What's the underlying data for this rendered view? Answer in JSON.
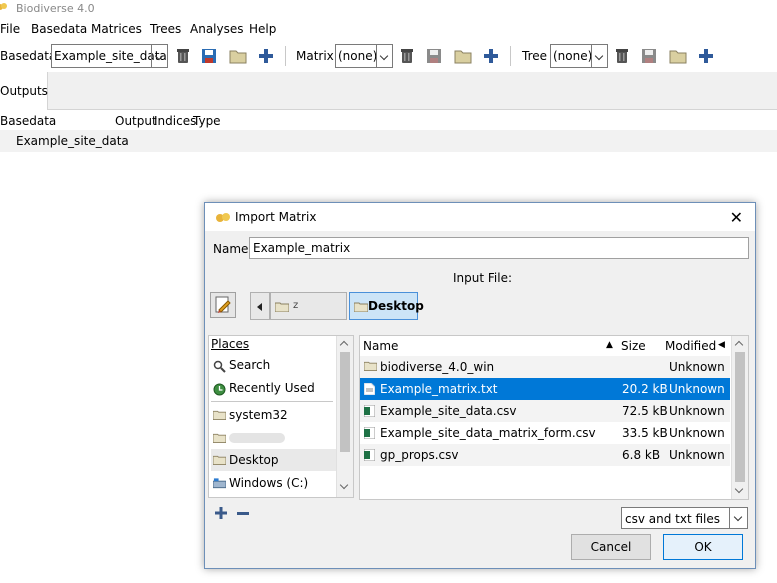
{
  "app": {
    "title": "Biodiverse 4.0"
  },
  "menu": {
    "items": [
      "File",
      "Basedata",
      "Matrices",
      "Trees",
      "Analyses",
      "Help"
    ]
  },
  "toolbar": {
    "basedata_label": "Basedata",
    "basedata_value": "Example_site_data",
    "matrix_label": "Matrix",
    "matrix_value": "(none)",
    "tree_label": "Tree",
    "tree_value": "(none)"
  },
  "tabs": {
    "outputs": "Outputs"
  },
  "outputs_table": {
    "columns": [
      "Basedata",
      "Output",
      "Indices",
      "Type"
    ],
    "rows": [
      "Example_site_data"
    ]
  },
  "dialog": {
    "title": "Import Matrix",
    "name_label": "Name",
    "name_value": "Example_matrix",
    "input_file_label": "Input File:",
    "breadcrumb_current": "Desktop",
    "places": {
      "header": "Places",
      "items": [
        "Search",
        "Recently Used",
        "system32",
        "Desktop",
        "Windows (C:)"
      ]
    },
    "files": {
      "columns": {
        "name": "Name",
        "size": "Size",
        "modified": "Modified"
      },
      "rows": [
        {
          "name": "biodiverse_4.0_win",
          "size": "",
          "modified": "Unknown"
        },
        {
          "name": "Example_matrix.txt",
          "size": "20.2 kB",
          "modified": "Unknown"
        },
        {
          "name": "Example_site_data.csv",
          "size": "72.5 kB",
          "modified": "Unknown"
        },
        {
          "name": "Example_site_data_matrix_form.csv",
          "size": "33.5 kB",
          "modified": "Unknown"
        },
        {
          "name": "gp_props.csv",
          "size": "6.8 kB",
          "modified": "Unknown"
        }
      ],
      "selected_index": 1
    },
    "filter_value": "csv and txt files",
    "buttons": {
      "cancel": "Cancel",
      "ok": "OK"
    }
  }
}
